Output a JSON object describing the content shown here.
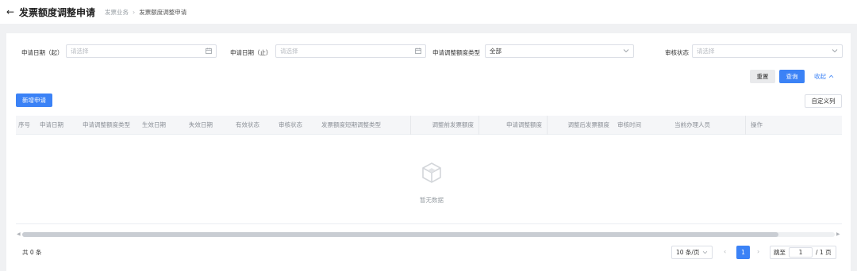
{
  "header": {
    "back_icon": "←",
    "title": "发票额度调整申请",
    "breadcrumb": [
      "发票业务",
      "发票额度调整申请"
    ],
    "breadcrumb_sep": "›"
  },
  "filters": [
    {
      "label": "申请日期（起）",
      "placeholder": "请选择",
      "icon": "calendar-icon"
    },
    {
      "label": "申请日期（止）",
      "placeholder": "请选择",
      "icon": "calendar-icon"
    },
    {
      "label": "申请调整额度类型",
      "value": "全部",
      "icon": "chevron-down-icon"
    },
    {
      "label": "审核状态",
      "placeholder": "请选择",
      "icon": "chevron-down-icon"
    }
  ],
  "actions": {
    "reset": "重置",
    "query": "查询",
    "collapse": "收起",
    "add": "新增申请",
    "custom_columns": "自定义列"
  },
  "table": {
    "columns": [
      "序号",
      "申请日期",
      "申请调整额度类型",
      "生效日期",
      "失效日期",
      "有效状态",
      "审核状态",
      "发票额度短期调整类型",
      "调整前发票额度",
      "申请调整额度",
      "调整后发票额度",
      "审核时间",
      "当前办理人员",
      "操作"
    ],
    "rows": [],
    "empty_text": "暂无数据"
  },
  "pagination": {
    "total": "共 0 条",
    "page_size": "10 条/页",
    "current_page": "1",
    "jump_label": "跳至",
    "jump_value": "1",
    "page_total": "/ 1 页"
  },
  "colors": {
    "primary": "#3b82f6",
    "page_bg": "#f0f1f3"
  }
}
